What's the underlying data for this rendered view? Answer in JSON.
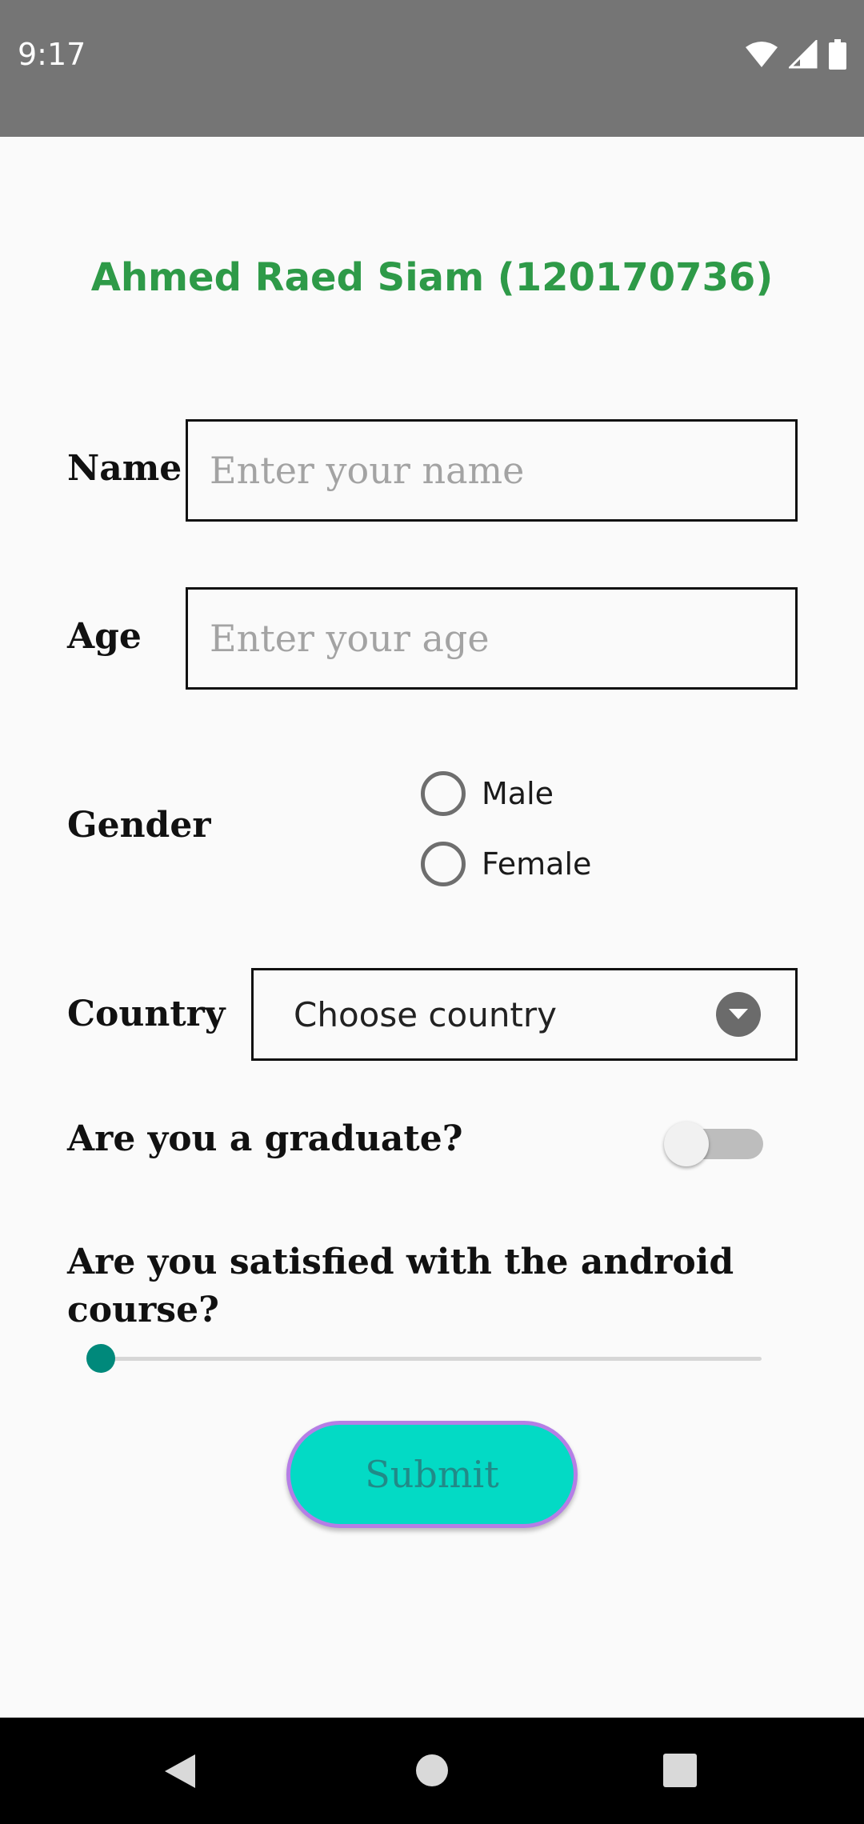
{
  "status_bar": {
    "time": "9:17",
    "icons": [
      "wifi-icon",
      "signal-icon",
      "battery-icon"
    ],
    "background": "#757575"
  },
  "header": {
    "title": "Ahmed Raed Siam (120170736)",
    "title_color": "#2e9a48"
  },
  "form": {
    "name": {
      "label": "Name",
      "placeholder": "Enter your name",
      "value": ""
    },
    "age": {
      "label": "Age",
      "placeholder": "Enter your age",
      "value": ""
    },
    "gender": {
      "label": "Gender",
      "options": [
        {
          "label": "Male",
          "selected": false
        },
        {
          "label": "Female",
          "selected": false
        }
      ]
    },
    "country": {
      "label": "Country",
      "selected": "Choose country"
    },
    "graduate": {
      "label": "Are you a graduate?",
      "checked": false
    },
    "satisfaction": {
      "label": "Are you satisfied with the android course?",
      "value": 0
    },
    "submit_label": "Submit"
  },
  "colors": {
    "accent": "#00897b",
    "button_fill": "#03dac5",
    "button_border": "#b57ee6",
    "button_text": "#218a88"
  },
  "nav_bar": {
    "buttons": [
      "back-icon",
      "home-icon",
      "recents-icon"
    ]
  }
}
